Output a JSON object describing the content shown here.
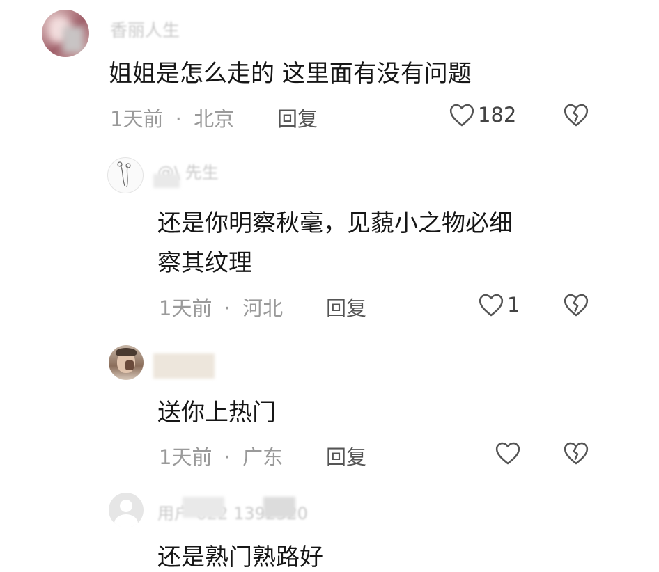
{
  "comments": [
    {
      "username": "香丽人生",
      "text": "姐姐是怎么走的 这里面有没有问题",
      "time": "1天前",
      "location": "北京",
      "reply_label": "回复",
      "likes": "182",
      "avatar_icon": "user-avatar-icon"
    },
    {
      "username": "@\\ 先生",
      "text_line1": "还是你明察秋毫，见藐小之物必细",
      "text_line2": "察其纹理",
      "time": "1天前",
      "location": "河北",
      "reply_label": "回复",
      "likes": "1",
      "avatar_icon": "user-avatar-icon"
    },
    {
      "username": "",
      "text": "送你上热门",
      "time": "1天前",
      "location": "广东",
      "reply_label": "回复",
      "likes": "",
      "avatar_icon": "user-avatar-icon"
    },
    {
      "username": "用户 022 1392520",
      "text": "还是熟门熟路好",
      "avatar_icon": "default-avatar-icon"
    }
  ],
  "separator": "·",
  "icons": {
    "like": "heart-outline-icon",
    "dislike": "broken-heart-icon"
  }
}
